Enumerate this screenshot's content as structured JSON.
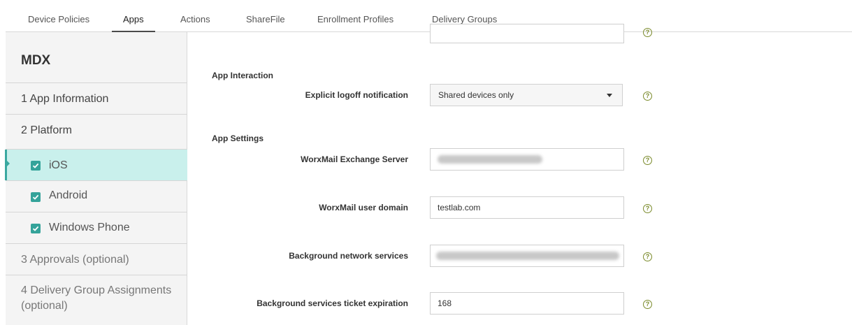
{
  "tabs": [
    {
      "label": "Device Policies"
    },
    {
      "label": "Apps"
    },
    {
      "label": "Actions"
    },
    {
      "label": "ShareFile"
    },
    {
      "label": "Enrollment Profiles"
    },
    {
      "label": "Delivery Groups"
    }
  ],
  "active_tab": "Apps",
  "sidebar": {
    "title": "MDX",
    "items": [
      {
        "label": "1  App Information"
      },
      {
        "label": "2  Platform"
      },
      {
        "label": "iOS",
        "checked": true,
        "active": true
      },
      {
        "label": "Android",
        "checked": true
      },
      {
        "label": "Windows Phone",
        "checked": true
      },
      {
        "label": "3  Approvals (optional)"
      },
      {
        "label": "4  Delivery Group Assignments",
        "label2": "(optional)"
      }
    ]
  },
  "form": {
    "sections": {
      "app_interaction": "App Interaction",
      "app_settings": "App Settings"
    },
    "fields": {
      "logoff": {
        "label": "Explicit logoff notification",
        "value": "Shared devices only"
      },
      "exchange": {
        "label": "WorxMail Exchange Server",
        "value": ""
      },
      "domain": {
        "label": "WorxMail user domain",
        "value": "testlab.com"
      },
      "bg_network": {
        "label": "Background network services",
        "value": ""
      },
      "ticket": {
        "label": "Background services ticket expiration",
        "value": "168"
      }
    },
    "help_glyph": "?"
  },
  "colors": {
    "accent": "#34a39a",
    "active_bg": "#c9f0ec",
    "sidebar_bg": "#f4f4f4",
    "help_icon": "#7a8a2a"
  }
}
